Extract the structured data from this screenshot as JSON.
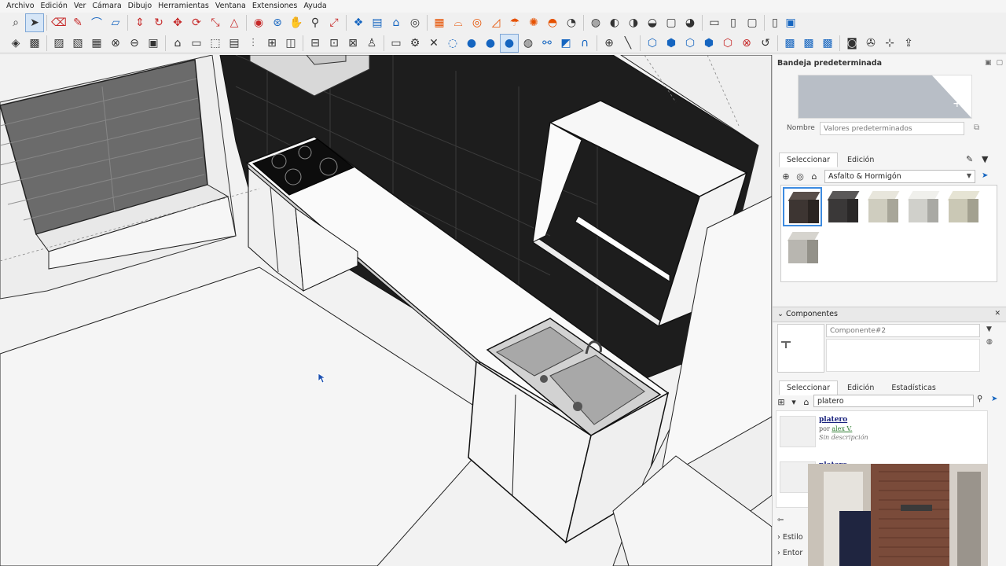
{
  "menubar": {
    "items": [
      "Archivo",
      "Edición",
      "Ver",
      "Cámara",
      "Dibujo",
      "Herramientas",
      "Ventana",
      "Extensiones",
      "Ayuda"
    ]
  },
  "toolbar_row1": {
    "icons": [
      "search-icon",
      "select-arrow-icon",
      "eraser-icon",
      "pencil-line-icon",
      "arc-icon",
      "rectangle-icon",
      "push-pull-icon",
      "follow-me-icon",
      "move-icon",
      "rotate-icon",
      "scale-icon",
      "tape-measure-icon",
      "paint-bucket-icon",
      "orbit-icon",
      "pan-icon",
      "zoom-icon",
      "zoom-extents-icon",
      "sandbox-icon",
      "stamp-icon",
      "warehouse-icon",
      "pushpin-icon",
      "styles-icon",
      "layers-icon",
      "scenes-icon",
      "section-icon",
      "solar-icon",
      "camera-icon",
      "outliner-icon",
      "entity-icon",
      "component-icon",
      "tag-icon",
      "extension-icon",
      "save-icon",
      "open-icon",
      "print-icon",
      "new-file-icon",
      "mobile-icon"
    ]
  },
  "toolbar_row2": {
    "icons": [
      "xray-icon",
      "backedges-icon",
      "wireframe-icon",
      "hidden-line-icon",
      "shaded-icon",
      "textured-icon",
      "monochrome-icon",
      "sketchy-icon",
      "box-icon",
      "iso-icon",
      "top-icon",
      "front-icon",
      "right-icon",
      "back-icon",
      "left-icon",
      "bottom-icon",
      "section-plane-icon",
      "section-fill-icon",
      "component-browser-icon",
      "gear-icon",
      "delete-icon",
      "water-drop-icon",
      "blue-drop-icon",
      "blue-drop-icon",
      "selected-drop-icon",
      "green-drop-icon",
      "link-icon",
      "plugin-red-icon",
      "plugin-blue-icon",
      "add-circle-icon",
      "line-tool-icon",
      "shape-icon",
      "shape-icon",
      "shape-icon",
      "shape-icon",
      "shape-icon",
      "red-shape-icon",
      "red-x-icon",
      "texture-icon",
      "texture-icon",
      "texture-icon",
      "ocl-icon",
      "export-icon",
      "tree-icon",
      "share-icon"
    ]
  },
  "tray": {
    "title": "Bandeja predeterminada",
    "materials": {
      "name_label": "Nombre",
      "name_placeholder": "Valores predeterminados",
      "tabs": [
        "Seleccionar",
        "Edición"
      ],
      "collection": "Asfalto & Hormigón",
      "swatches": [
        {
          "top": "#5a4f4a",
          "face": "#3d3532",
          "side": "#2a2421"
        },
        {
          "top": "#5a5858",
          "face": "#3a3838",
          "side": "#2a2828"
        },
        {
          "top": "#e8e6dc",
          "face": "#cfcdbf",
          "side": "#a8a699"
        },
        {
          "top": "#f0f0ec",
          "face": "#d0d0cb",
          "side": "#a9a9a4"
        },
        {
          "top": "#e6e4d4",
          "face": "#cac8b5",
          "side": "#a3a190"
        },
        {
          "top": "#d6d4ce",
          "face": "#b8b6b0",
          "side": "#939189"
        }
      ]
    },
    "components": {
      "section_label": "Componentes",
      "name_placeholder": "Componente#2",
      "tabs": [
        "Seleccionar",
        "Edición",
        "Estadísticas"
      ],
      "search_value": "platero",
      "results": [
        {
          "title": "platero",
          "by": "por",
          "author": "alex V.",
          "desc": "Sin descripción"
        },
        {
          "title": "platero",
          "by": "",
          "author": "",
          "desc": ""
        }
      ]
    },
    "collapsed_sections": [
      "Estilos",
      "Entorno"
    ],
    "collapsed_visible": [
      "Estilo",
      "Entor"
    ]
  },
  "colors": {
    "accent": "#3d8be0",
    "toolbar_red": "#c62828",
    "toolbar_blue": "#1565c0",
    "link_green": "#2e7d32"
  }
}
